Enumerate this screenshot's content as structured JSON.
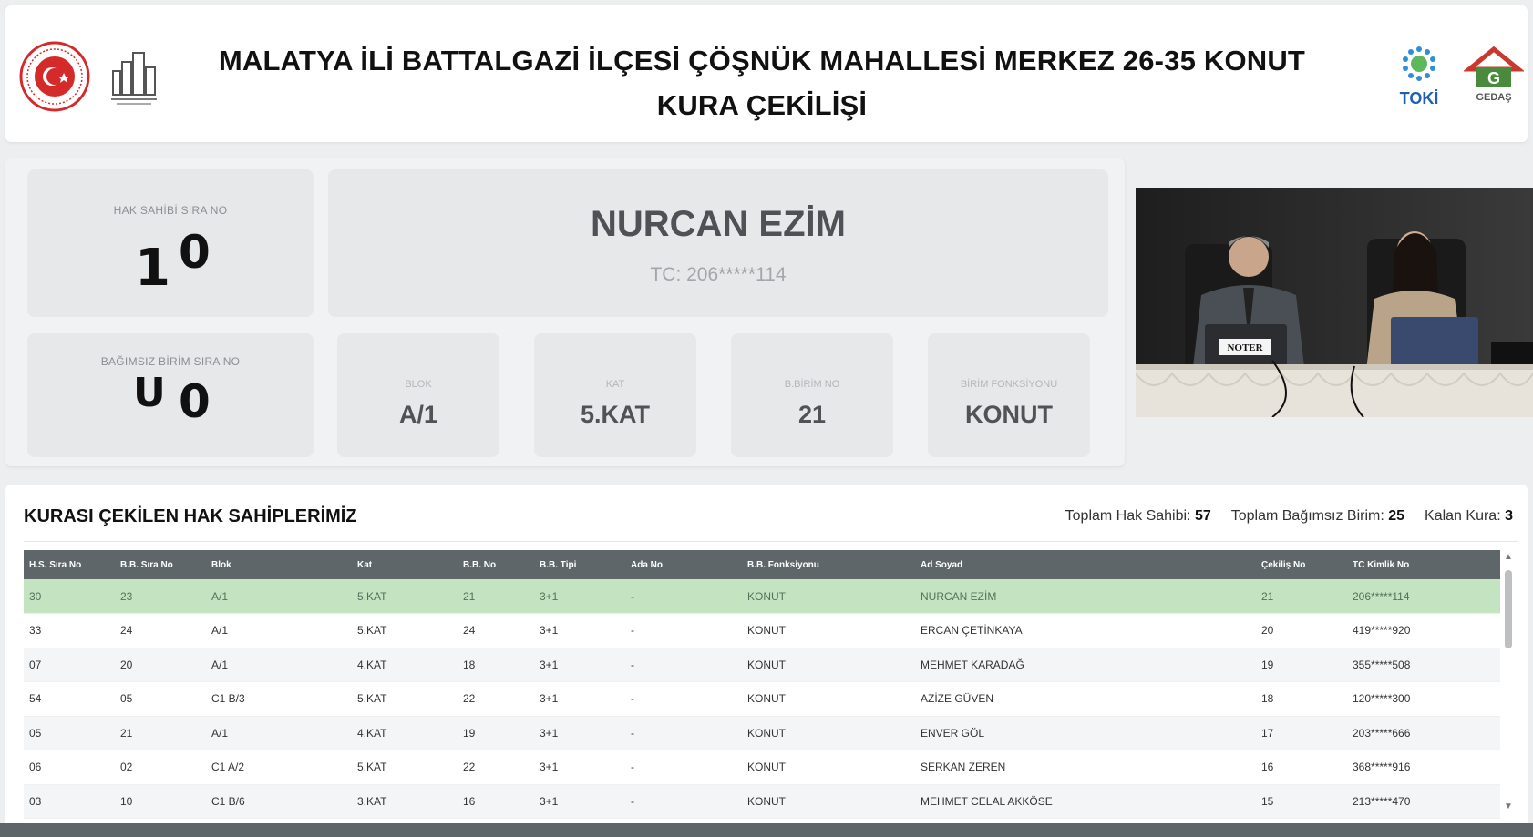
{
  "header": {
    "title": "MALATYA İLİ BATTALGAZİ İLÇESİ ÇÖŞNÜK MAHALLESİ MERKEZ 26-35 KONUT KURA ÇEKİLİŞİ",
    "logos": {
      "seal": "government-seal-icon",
      "mimari": "building-logo-icon",
      "toki": "TOKİ",
      "gedas": "GEDAŞ"
    }
  },
  "draw": {
    "hak_sahibi_label": "HAK SAHİBİ SIRA NO",
    "hak_sahibi_digit1": "1",
    "hak_sahibi_digit2": "0",
    "bagimsiz_birim_label": "BAĞIMSIZ BİRİM SIRA NO",
    "bagimsiz_birim_digit1": "U",
    "bagimsiz_birim_digit2": "0",
    "person_name": "NURCAN EZİM",
    "person_tc": "TC: 206*****114",
    "details": [
      {
        "label": "BLOK",
        "value": "A/1"
      },
      {
        "label": "KAT",
        "value": "5.KAT"
      },
      {
        "label": "B.BİRİM NO",
        "value": "21"
      },
      {
        "label": "BİRİM FONKSİYONU",
        "value": "KONUT"
      }
    ]
  },
  "video": {
    "placard": "NOTER"
  },
  "table": {
    "title": "KURASI ÇEKİLEN HAK SAHİPLERİMİZ",
    "stats": {
      "toplam_hak_sahibi_label": "Toplam Hak Sahibi:",
      "toplam_hak_sahibi_value": "57",
      "toplam_bagimsiz_birim_label": "Toplam Bağımsız Birim:",
      "toplam_bagimsiz_birim_value": "25",
      "kalan_kura_label": "Kalan Kura:",
      "kalan_kura_value": "3"
    },
    "columns": [
      "H.S. Sıra No",
      "B.B. Sıra No",
      "Blok",
      "Kat",
      "B.B. No",
      "B.B. Tipi",
      "Ada No",
      "B.B. Fonksiyonu",
      "Ad Soyad",
      "Çekiliş No",
      "TC Kimlik No"
    ],
    "rows": [
      [
        "30",
        "23",
        "A/1",
        "5.KAT",
        "21",
        "3+1",
        "-",
        "KONUT",
        "NURCAN EZİM",
        "21",
        "206*****114"
      ],
      [
        "33",
        "24",
        "A/1",
        "5.KAT",
        "24",
        "3+1",
        "-",
        "KONUT",
        "ERCAN ÇETİNKAYA",
        "20",
        "419*****920"
      ],
      [
        "07",
        "20",
        "A/1",
        "4.KAT",
        "18",
        "3+1",
        "-",
        "KONUT",
        "MEHMET KARADAĞ",
        "19",
        "355*****508"
      ],
      [
        "54",
        "05",
        "C1 B/3",
        "5.KAT",
        "22",
        "3+1",
        "-",
        "KONUT",
        "AZİZE GÜVEN",
        "18",
        "120*****300"
      ],
      [
        "05",
        "21",
        "A/1",
        "4.KAT",
        "19",
        "3+1",
        "-",
        "KONUT",
        "ENVER GÖL",
        "17",
        "203*****666"
      ],
      [
        "06",
        "02",
        "C1 A/2",
        "5.KAT",
        "22",
        "3+1",
        "-",
        "KONUT",
        "SERKAN ZEREN",
        "16",
        "368*****916"
      ],
      [
        "03",
        "10",
        "C1 B/6",
        "3.KAT",
        "16",
        "3+1",
        "-",
        "KONUT",
        "MEHMET CELAL AKKÖSE",
        "15",
        "213*****470"
      ]
    ]
  },
  "colors": {
    "highlight_row": "#c4e3c1",
    "table_header": "#5f6669",
    "toki_blue": "#1f5fae",
    "gedas_green": "#4a8a3c",
    "gedas_red": "#c8392f",
    "seal_red": "#d42a2a"
  }
}
